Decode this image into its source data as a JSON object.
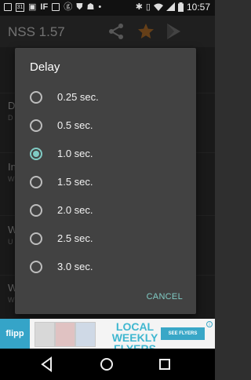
{
  "status_bar": {
    "left_icons": [
      "notification-box-icon",
      "calendar-icon",
      "image-icon",
      "if-icon",
      "box-icon",
      "g-icon",
      "shield-icon",
      "android-icon",
      "dot-icon"
    ],
    "calendar_day": "31",
    "if_label": "IF",
    "right_icons": [
      "bluetooth-icon",
      "vibrate-icon",
      "wifi-icon",
      "cell-signal-icon",
      "battery-icon"
    ],
    "time": "10:57"
  },
  "app_bar": {
    "title": "NSS 1.57",
    "actions": [
      "share-icon",
      "star-icon",
      "play-store-icon"
    ]
  },
  "background_list": [
    {
      "title": "D",
      "sub": "D"
    },
    {
      "title": "In",
      "sub": "W"
    },
    {
      "title": "W",
      "sub": "U"
    },
    {
      "title": "W",
      "sub": "W"
    }
  ],
  "dialog": {
    "title": "Delay",
    "options": [
      {
        "label": "0.25 sec.",
        "checked": false
      },
      {
        "label": "0.5 sec.",
        "checked": false
      },
      {
        "label": "1.0 sec.",
        "checked": true
      },
      {
        "label": "1.5 sec.",
        "checked": false
      },
      {
        "label": "2.0 sec.",
        "checked": false
      },
      {
        "label": "2.5 sec.",
        "checked": false
      },
      {
        "label": "3.0 sec.",
        "checked": false
      }
    ],
    "cancel_label": "CANCEL",
    "accent_color": "#80cbc4"
  },
  "ad_banner": {
    "logo": "flipp",
    "headline": "LOCAL WEEKLY FLYERS",
    "button": "SEE FLYERS"
  },
  "nav_bar": [
    "back-icon",
    "home-icon",
    "recents-icon"
  ]
}
